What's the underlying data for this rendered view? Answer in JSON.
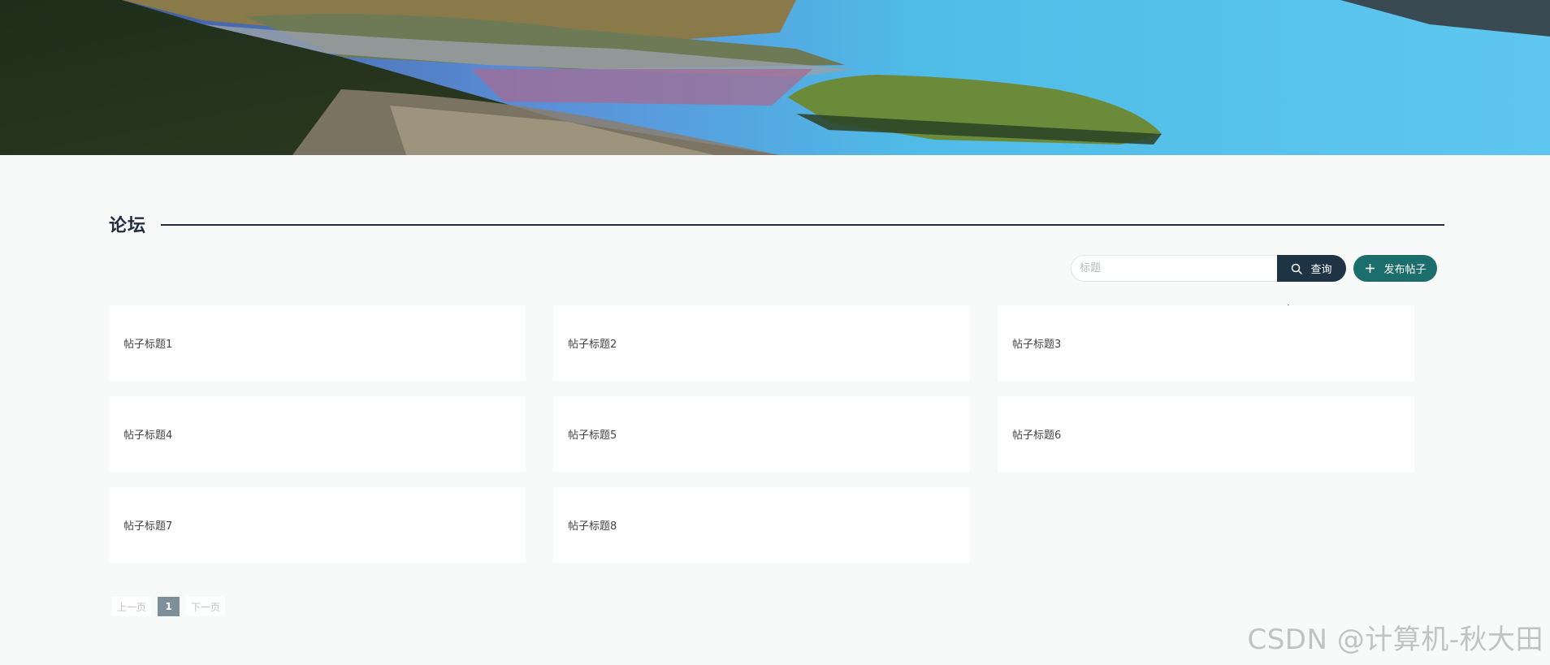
{
  "section": {
    "title": "论坛"
  },
  "search": {
    "placeholder": "标题",
    "value": ""
  },
  "toolbar": {
    "query_label": "查询",
    "publish_label": "发布帖子",
    "query_icon": "search-icon",
    "publish_icon": "plus-icon",
    "query_color": "#1e3444",
    "publish_color": "#1c6e6c"
  },
  "posts": [
    {
      "title": "帖子标题1"
    },
    {
      "title": "帖子标题2"
    },
    {
      "title": "帖子标题3"
    },
    {
      "title": "帖子标题4"
    },
    {
      "title": "帖子标题5"
    },
    {
      "title": "帖子标题6"
    },
    {
      "title": "帖子标题7"
    },
    {
      "title": "帖子标题8"
    }
  ],
  "pagination": {
    "prev_label": "上一页",
    "current": "1",
    "next_label": "下一页"
  },
  "watermark": "CSDN @计算机-秋大田"
}
